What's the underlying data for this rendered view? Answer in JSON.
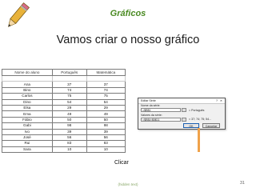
{
  "header": "Gráficos",
  "title": "Vamos criar o nosso gráfico",
  "table": {
    "headers": [
      "Nome do aluno",
      "Português",
      "Matemática"
    ],
    "rows": [
      [
        "Ana",
        "37",
        "37"
      ],
      [
        "Bino",
        "74",
        "74"
      ],
      [
        "Carlos",
        "75",
        "75"
      ],
      [
        "Dino",
        "54",
        "54"
      ],
      [
        "Elsa",
        "29",
        "29"
      ],
      [
        "Ema",
        "49",
        "49"
      ],
      [
        "Fábio",
        "50",
        "50"
      ],
      [
        "Gabi",
        "98",
        "98"
      ],
      [
        "Ivo",
        "39",
        "39"
      ],
      [
        "José",
        "56",
        "56"
      ],
      [
        "Rui",
        "83",
        "83"
      ],
      [
        "Sara",
        "10",
        "10"
      ]
    ]
  },
  "dialog": {
    "title": "Editar Série",
    "help": "?",
    "close": "✕",
    "name_label": "Nome da série:",
    "name_value": "=$B$1",
    "name_preview": "= Português",
    "values_label": "Valores da série:",
    "values_value": "=$B$4:$B$11",
    "values_preview": "= 37; 74; 75; 54...",
    "ok_label": "OK",
    "cancel_label": "Cancelar"
  },
  "callout": "Clicar",
  "footer": "(hidden text)",
  "page_number": "31",
  "colors": {
    "header": "#4a8a22",
    "callout": "#f0a24a",
    "ok_border": "#1c5fb0"
  }
}
